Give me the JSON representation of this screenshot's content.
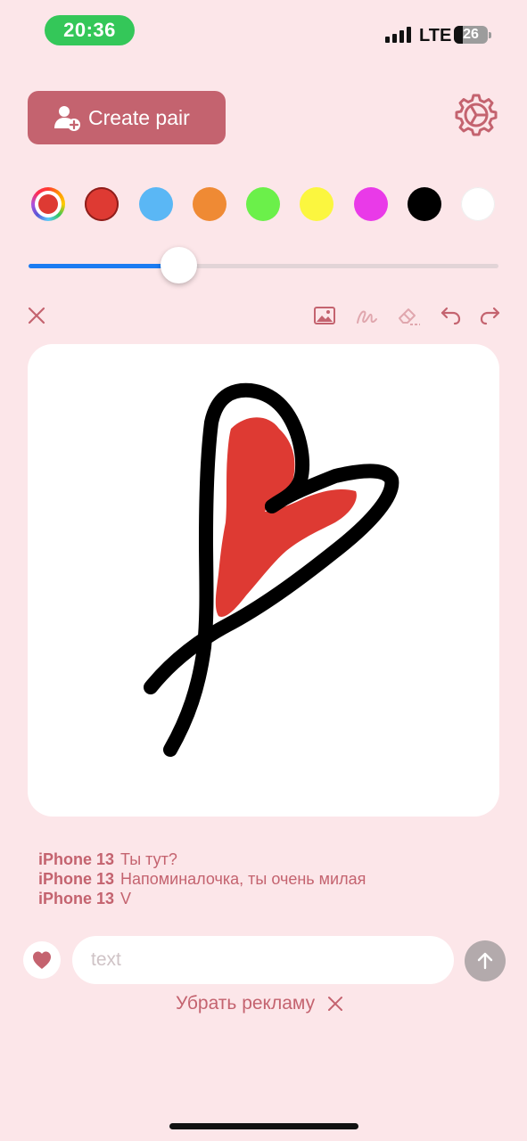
{
  "status_bar": {
    "time": "20:36",
    "network": "LTE",
    "battery": "26",
    "battery_level_percent": 26
  },
  "header": {
    "create_pair_label": "Create pair",
    "create_pair_icon": "add-user-icon",
    "settings_icon": "gear-icon"
  },
  "palette": {
    "selected": "#de3a33",
    "colors": [
      "rainbow",
      "#de3a33",
      "#5ab7f5",
      "#ef8a34",
      "#6bf04a",
      "#fbf63f",
      "#e93ae8",
      "#000000",
      "#ffffff"
    ]
  },
  "brush": {
    "size_fraction": 0.32
  },
  "toolbar": {
    "icons": [
      "close-icon",
      "image-icon",
      "pen-icon",
      "eraser-icon",
      "undo-icon",
      "redo-icon"
    ]
  },
  "messages": [
    {
      "sender": "iPhone 13",
      "text": "Ты тут?"
    },
    {
      "sender": "iPhone 13",
      "text": "Напоминалочка, ты очень милая"
    },
    {
      "sender": "iPhone 13",
      "text": "V"
    }
  ],
  "composer": {
    "placeholder": "text",
    "heart_icon": "heart-icon",
    "send_icon": "arrow-up-icon"
  },
  "ads": {
    "remove_label": "Убрать рекламу"
  },
  "theme": {
    "background": "#fce6e9",
    "accent": "#c4636f",
    "slider": "#1b7cf2"
  }
}
